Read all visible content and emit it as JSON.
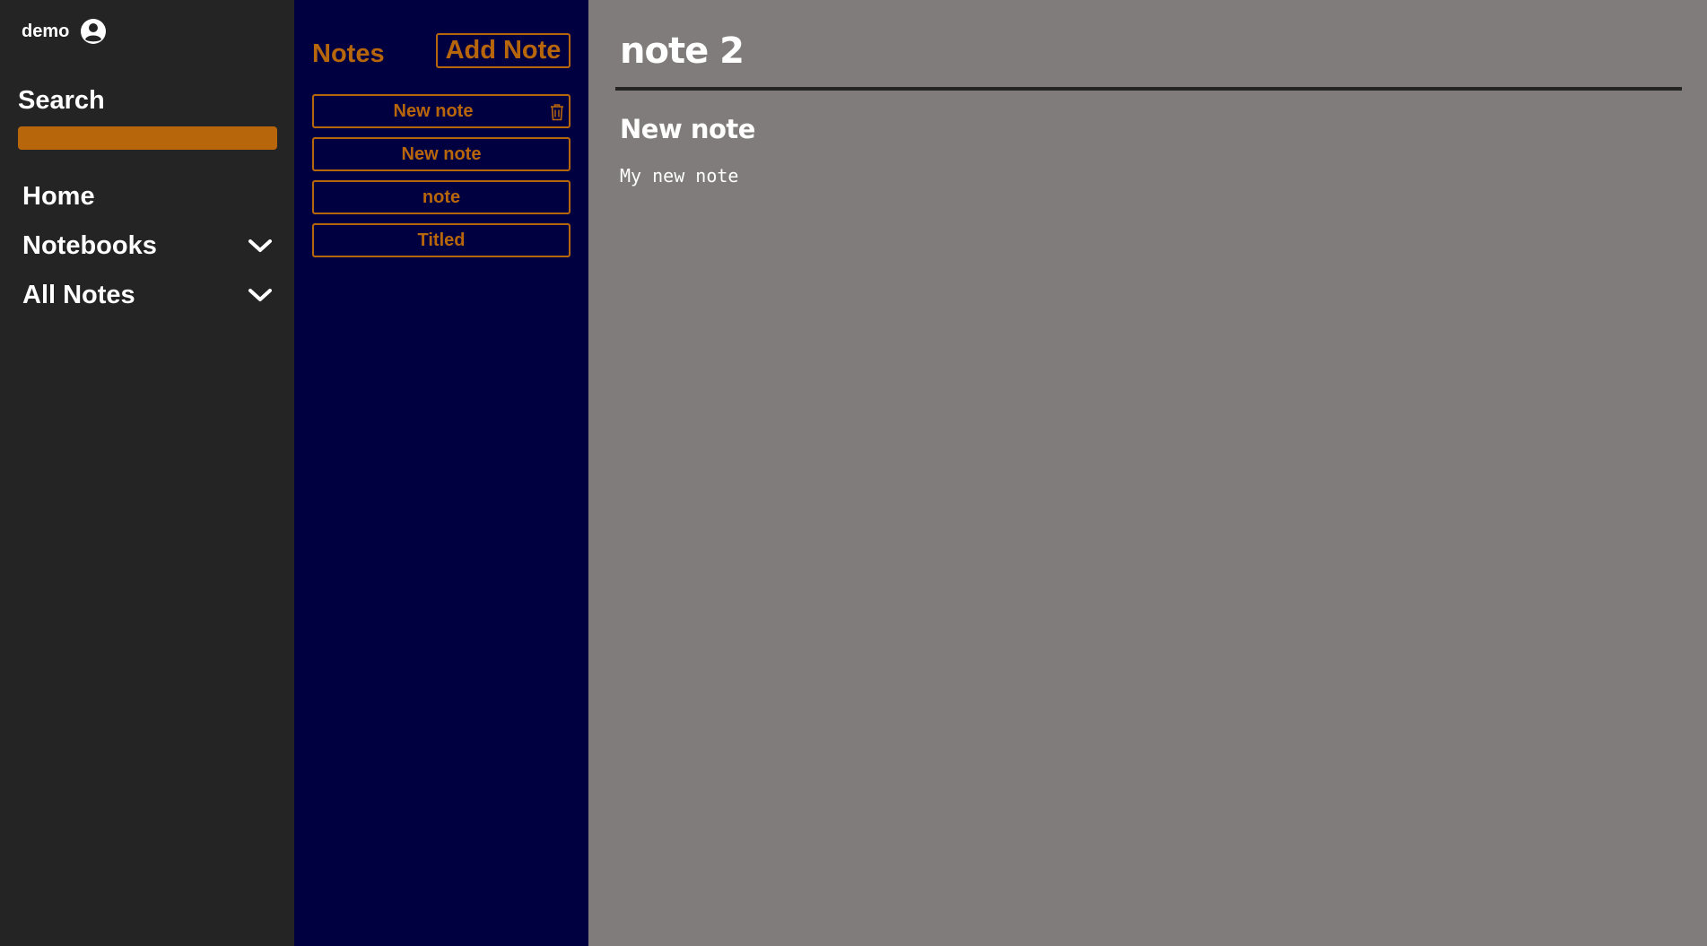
{
  "sidebar": {
    "username": "demo",
    "user_icon": "user-circle-icon",
    "search": {
      "label": "Search",
      "value": "",
      "placeholder": ""
    },
    "nav": [
      {
        "label": "Home"
      },
      {
        "label": "Notebooks",
        "icon": "chevron-down-icon"
      },
      {
        "label": "All Notes",
        "icon": "chevron-down-icon"
      }
    ]
  },
  "notes_panel": {
    "title": "Notes",
    "add_button": "Add Note",
    "notes": [
      {
        "title": "New note",
        "icon": "trash-icon"
      },
      {
        "title": "New note"
      },
      {
        "title": "note"
      },
      {
        "title": "Titled"
      }
    ]
  },
  "editor": {
    "title": "note 2",
    "heading": "New note",
    "body": "My new note"
  },
  "colors": {
    "sidebar_bg": "#242424",
    "notes_bg": "#000040",
    "editor_bg": "#807c7b",
    "accent": "#b8660b",
    "text": "#ffffff"
  }
}
